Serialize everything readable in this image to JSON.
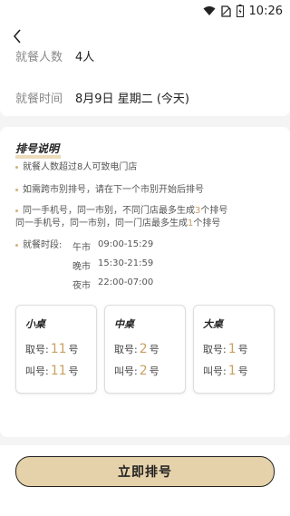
{
  "status_bar": {
    "time": "10:26"
  },
  "summary": {
    "party_label": "就餐人数",
    "party_value": "4人",
    "date_label": "就餐时间",
    "date_value": "8月9日 星期二 (今天)"
  },
  "info": {
    "title": "排号说明",
    "rule1": "就餐人数超过8人可致电门店",
    "rule2": "如需跨市别排号，请在下一个市别开始后排号",
    "rule3a_prefix": "同一手机号，同一市别，不同门店最多生成",
    "rule3a_num": "3",
    "rule3a_suffix": "个排号",
    "rule3b_prefix": "同一手机号，同一市别，同一门店最多生成",
    "rule3b_num": "1",
    "rule3b_suffix": "个排号",
    "hours_label": "就餐时段:",
    "periods": [
      {
        "name": "午市",
        "time": "09:00-15:29"
      },
      {
        "name": "晚市",
        "time": "15:30-21:59"
      },
      {
        "name": "夜市",
        "time": "22:00-07:00"
      }
    ]
  },
  "tables": [
    {
      "name": "小桌",
      "take_label": "取号:",
      "take_num": "11",
      "call_label": "叫号:",
      "call_num": "11",
      "unit": "号"
    },
    {
      "name": "中桌",
      "take_label": "取号:",
      "take_num": "2",
      "call_label": "叫号:",
      "call_num": "2",
      "unit": "号"
    },
    {
      "name": "大桌",
      "take_label": "取号:",
      "take_num": "1",
      "call_label": "叫号:",
      "call_num": "1",
      "unit": "号"
    }
  ],
  "action": {
    "queue_label": "立即排号"
  },
  "colors": {
    "accent": "#c9a063",
    "button_bg": "#e6d2aa"
  }
}
